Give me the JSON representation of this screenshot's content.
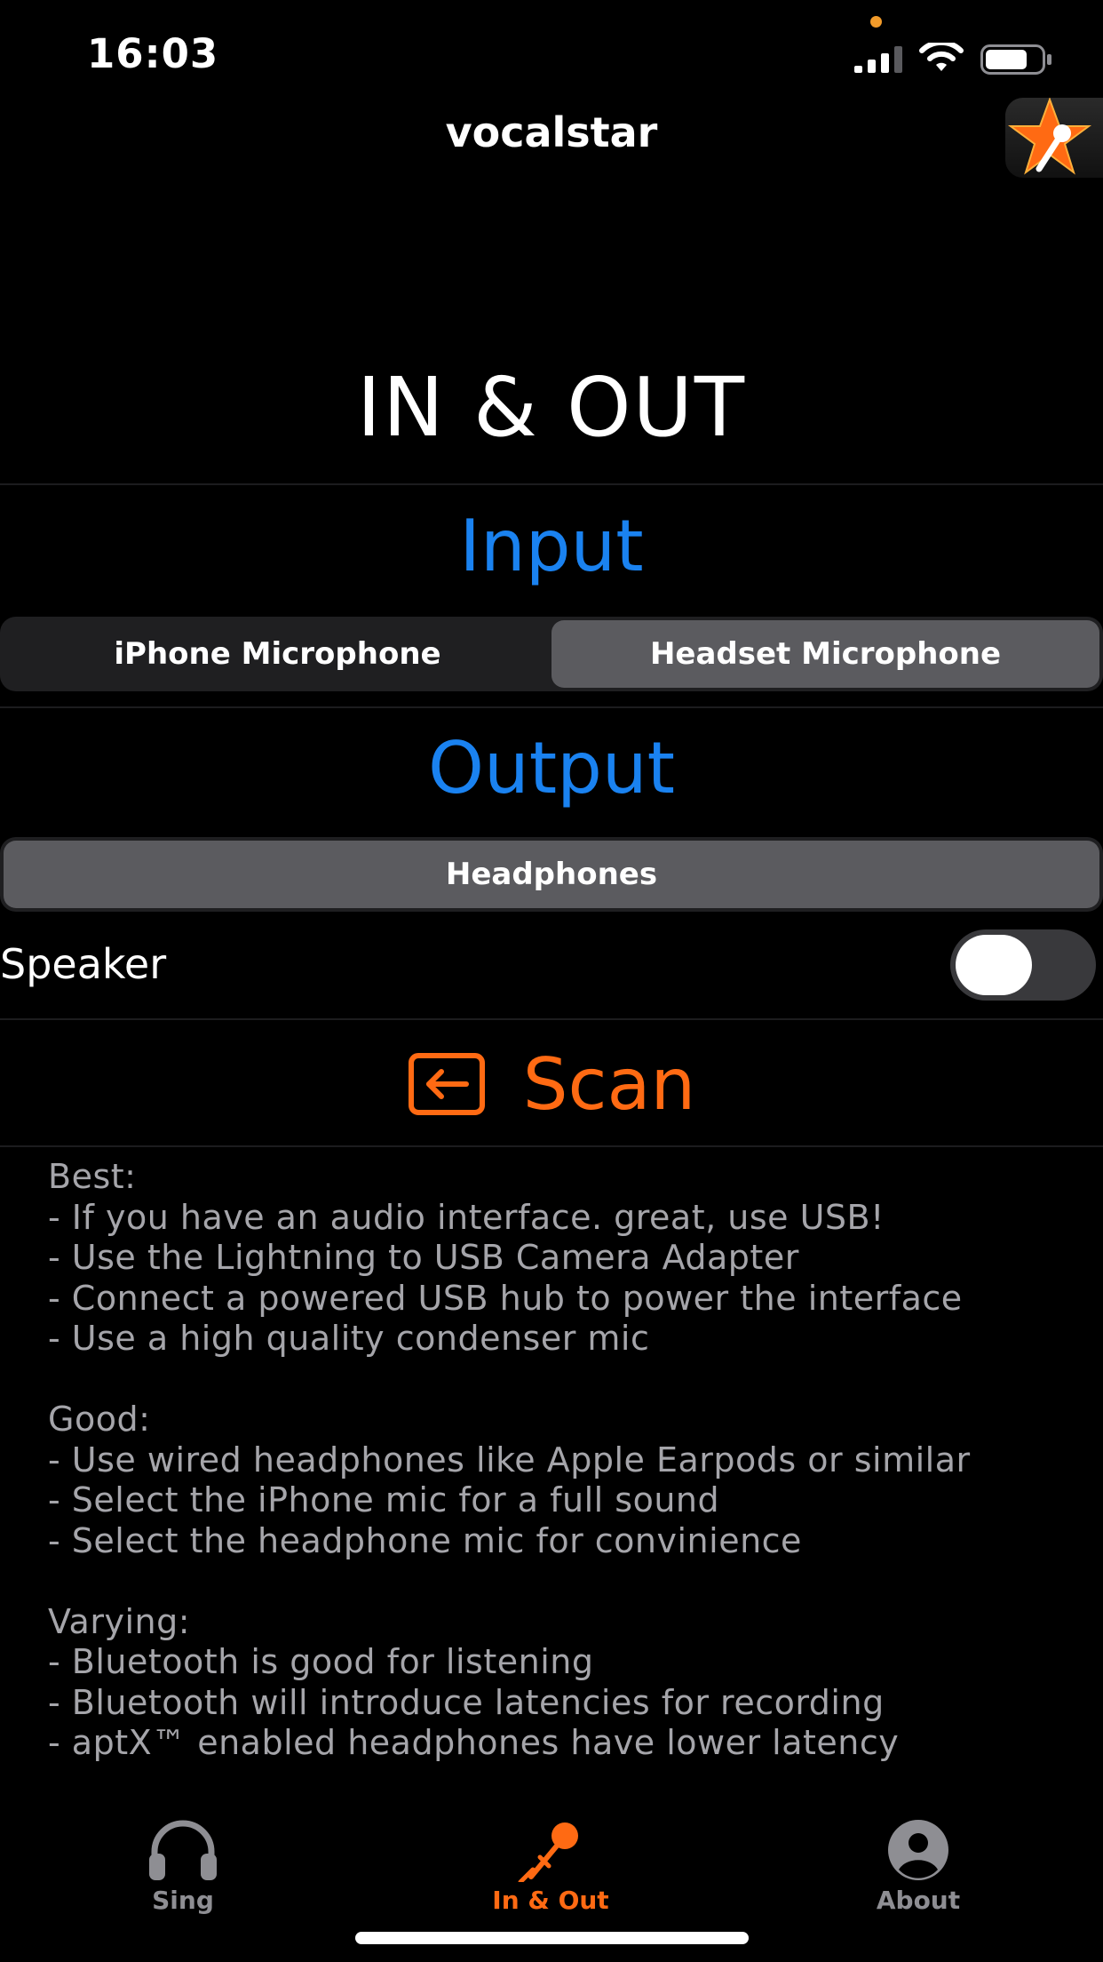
{
  "status_bar": {
    "time": "16:03"
  },
  "nav": {
    "title": "vocalstar"
  },
  "page_heading": "IN & OUT",
  "input": {
    "heading": "Input",
    "options": [
      "iPhone Microphone",
      "Headset Microphone"
    ],
    "selected": "Headset Microphone"
  },
  "output": {
    "heading": "Output",
    "options": [
      "Headphones"
    ],
    "selected": "Headphones",
    "speaker_label": "Speaker",
    "speaker_on": false
  },
  "scan": {
    "label": "Scan"
  },
  "info": {
    "best": {
      "title": "Best:",
      "lines": [
        "- If you have an audio interface. great, use USB!",
        "- Use the Lightning to USB Camera Adapter",
        "- Connect a powered USB hub to power the interface",
        "- Use a high quality condenser mic"
      ]
    },
    "good": {
      "title": "Good:",
      "lines": [
        "- Use wired headphones like Apple Earpods or similar",
        "- Select the iPhone mic for a full sound",
        "- Select the headphone mic for convinience"
      ]
    },
    "varying": {
      "title": "Varying:",
      "lines": [
        "- Bluetooth is good for listening",
        "- Bluetooth will introduce latencies for recording",
        "- aptX™ enabled headphones have lower latency"
      ]
    }
  },
  "tabs": [
    {
      "label": "Sing",
      "icon": "headphones-icon",
      "active": false
    },
    {
      "label": "In & Out",
      "icon": "microphone-icon",
      "active": true
    },
    {
      "label": "About",
      "icon": "person-circle-icon",
      "active": false
    }
  ],
  "colors": {
    "accent_blue": "#1a82f0",
    "accent_orange": "#ff6a13",
    "inactive_gray": "#8e8e93"
  }
}
